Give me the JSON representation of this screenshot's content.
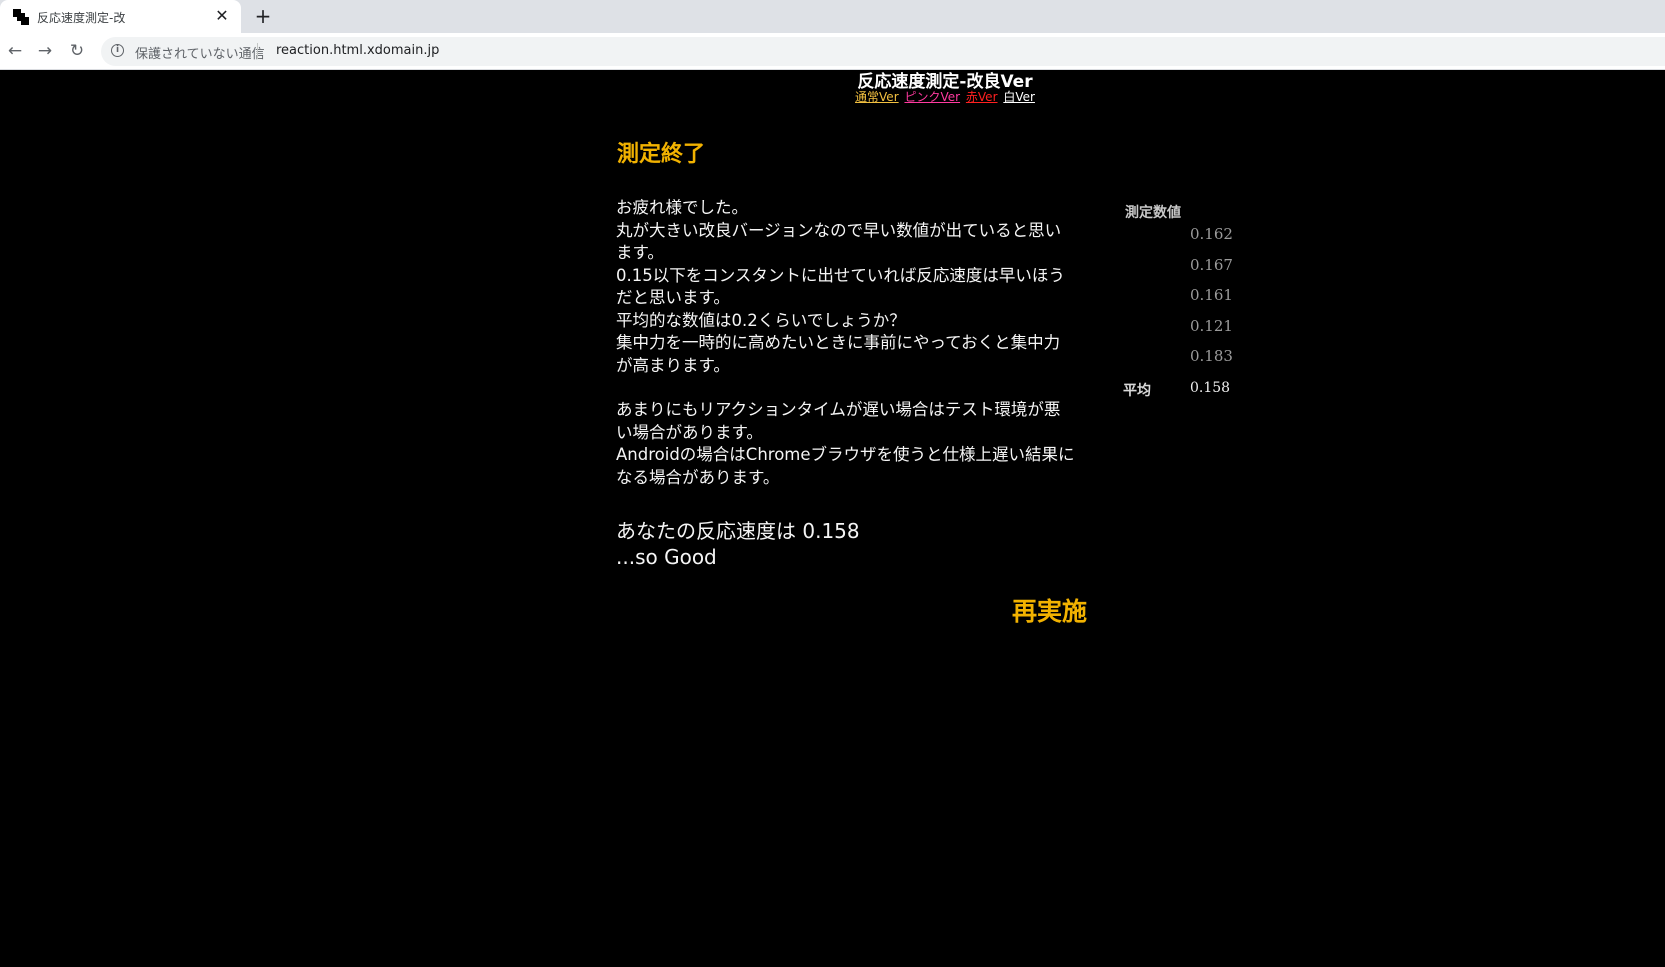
{
  "browser": {
    "tab_title": "反応速度測定-改",
    "tab_close": "✕",
    "new_tab": "+",
    "back": "←",
    "forward": "→",
    "reload": "↻",
    "security_label": "保護されていない通信",
    "url": "reaction.html.xdomain.jp"
  },
  "page": {
    "title": "反応速度測定-改良Ver",
    "variants": [
      {
        "label": "通常Ver",
        "color": "#f2c040"
      },
      {
        "label": "ピンクVer",
        "color": "#ff3aa0"
      },
      {
        "label": "赤Ver",
        "color": "#ff2020"
      },
      {
        "label": "白Ver",
        "color": "#ffffff"
      }
    ],
    "heading": "測定終了",
    "message_lines": [
      "お疲れ様でした。",
      "丸が大きい改良バージョンなので早い数値が出ていると思います。",
      "0.15以下をコンスタントに出せていれば反応速度は早いほうだと思います。",
      "平均的な数値は0.2くらいでしょうか？",
      "集中力を一時的に高めたいときに事前にやっておくと集中力が高まります。",
      "",
      "あまりにもリアクションタイムが遅い場合はテスト環境が悪い場合があります。",
      "Androidの場合はChromeブラウザを使うと仕様上遅い結果になる場合があります。"
    ],
    "result_line": "あなたの反応速度は 0.158",
    "rating_line": "...so Good",
    "retry_label": "再実施",
    "values_heading": "測定数値",
    "values": [
      "0.162",
      "0.167",
      "0.161",
      "0.121",
      "0.183"
    ],
    "average_label": "平均",
    "average_value": "0.158",
    "accent_color": "#f2b200"
  }
}
